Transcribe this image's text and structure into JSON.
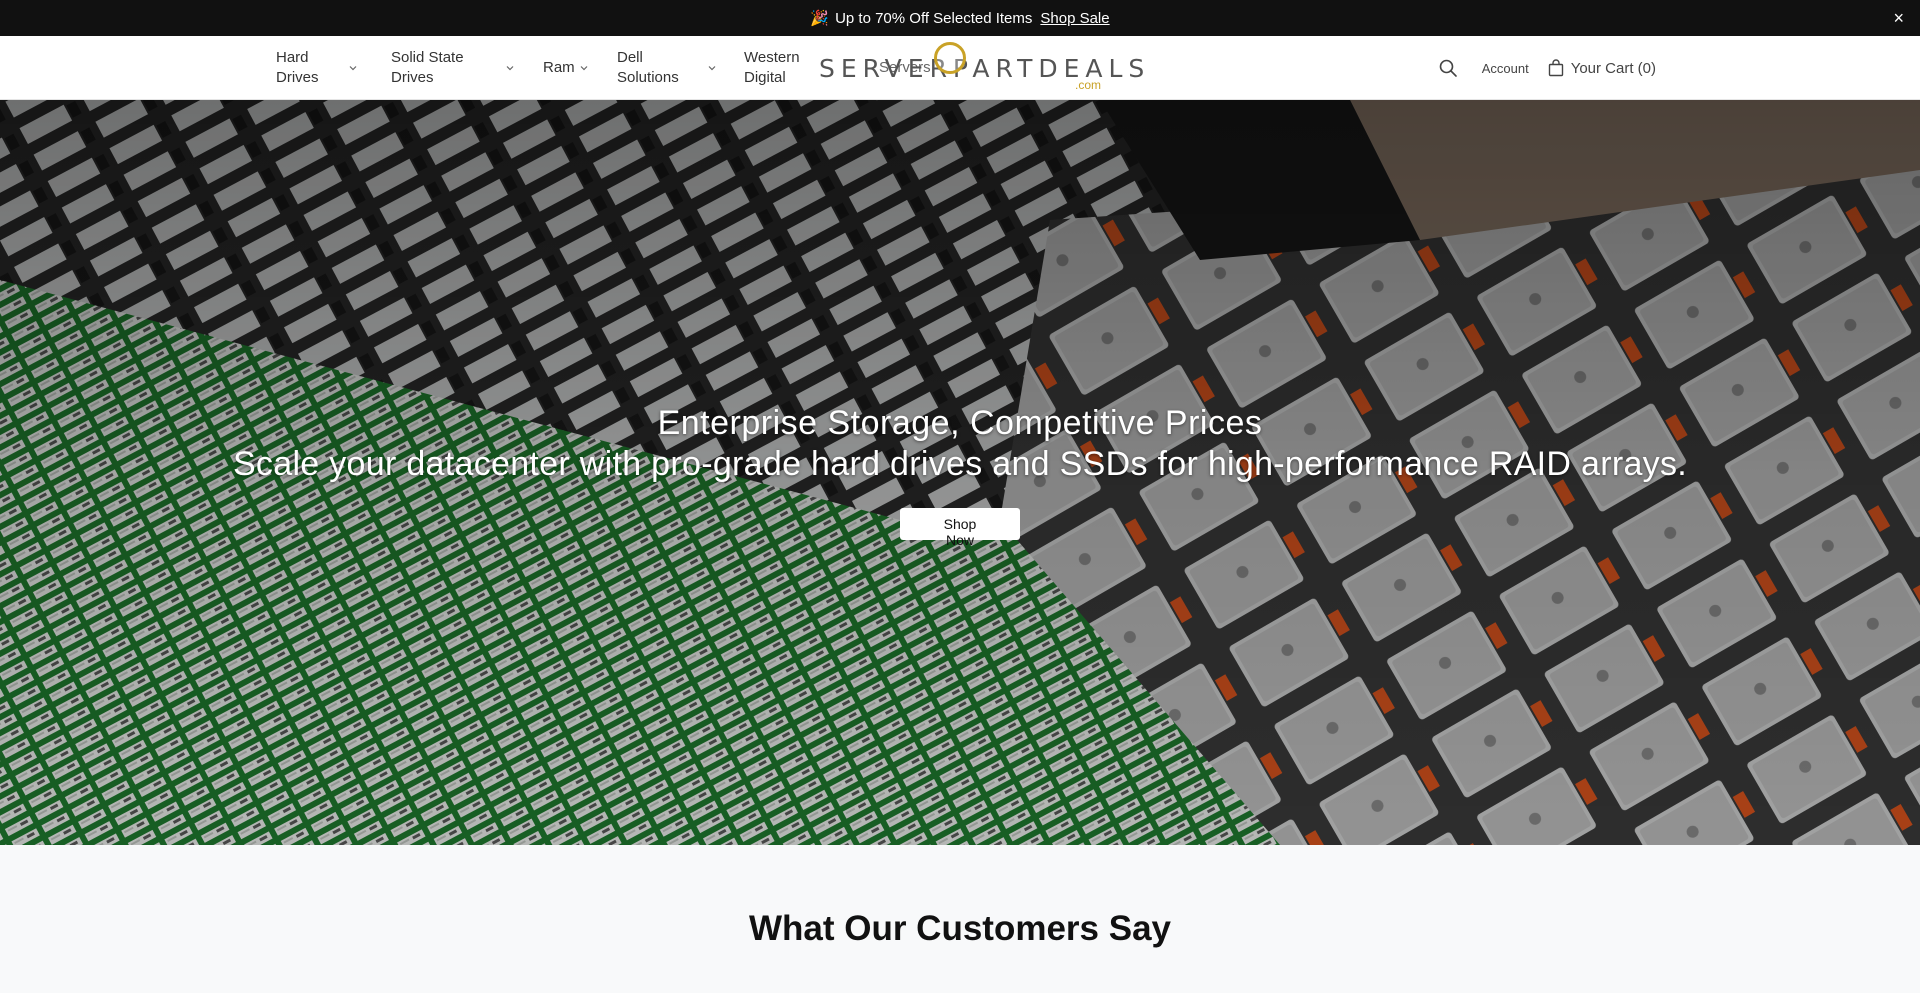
{
  "announcement": {
    "emoji": "🎉",
    "text": "Up to 70% Off Selected Items",
    "link": "Shop Sale",
    "close": "×"
  },
  "nav": {
    "items": [
      {
        "label": "Hard Drives"
      },
      {
        "label": "Solid State Drives"
      },
      {
        "label": "Ram"
      },
      {
        "label": "Dell Solutions"
      },
      {
        "label": "Western Digital"
      },
      {
        "label": "Servers"
      }
    ]
  },
  "logo": {
    "text": "SERVERPARTDEALS",
    "suffix": ".com"
  },
  "header": {
    "account": "Account",
    "cart": "Your Cart (0)"
  },
  "hero": {
    "title": "Enterprise Storage, Competitive Prices",
    "subtitle": "Scale your datacenter with pro-grade hard drives and SSDs for high-performance RAID arrays.",
    "button": "Shop Now"
  },
  "reviews": {
    "title": "What Our Customers Say"
  },
  "colors": {
    "announcement_bg": "#111111",
    "logo_accent": "#c9a227",
    "pcb_green": "#1f7a2e"
  }
}
